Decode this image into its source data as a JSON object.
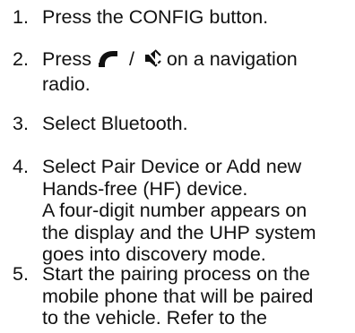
{
  "steps": [
    {
      "number": "1.",
      "lines": [
        "Press the CONFIG button."
      ]
    },
    {
      "number": "2.",
      "prefix": "Press",
      "separator": "/",
      "suffix": "on a navigation",
      "lines_after": [
        "radio."
      ],
      "icons": [
        "phone-icon",
        "mute-icon"
      ]
    },
    {
      "number": "3.",
      "lines": [
        "Select Bluetooth."
      ]
    },
    {
      "number": "4.",
      "lines": [
        "Select Pair Device or Add new",
        "Hands-free (HF) device.",
        "A four-digit number appears on",
        "the display and the UHP system",
        "goes into discovery mode."
      ]
    },
    {
      "number": "5.",
      "lines": [
        "Start the pairing process on the",
        "mobile phone that will be paired",
        "to the vehicle. Refer to the"
      ]
    }
  ]
}
